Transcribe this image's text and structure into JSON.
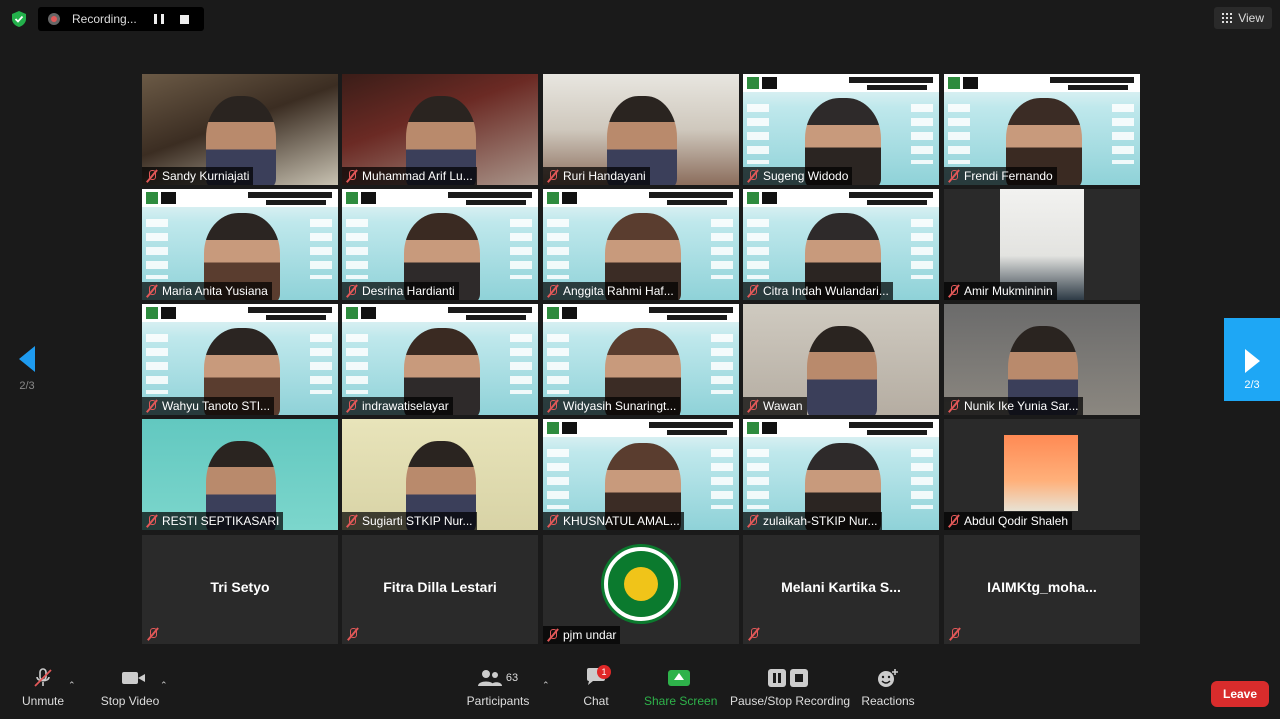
{
  "recording": {
    "label": "Recording..."
  },
  "view_button": {
    "label": "View"
  },
  "pagination": {
    "left_page": "2/3",
    "right_page": "2/3"
  },
  "tiles": [
    {
      "name": "Sandy Kurniajati",
      "cam": "room"
    },
    {
      "name": "Muhammad Arif Lu...",
      "cam": "red"
    },
    {
      "name": "Ruri Handayani",
      "cam": "bright"
    },
    {
      "name": "Sugeng Widodo",
      "cam": "slide"
    },
    {
      "name": "Frendi Fernando",
      "cam": "slide"
    },
    {
      "name": "Maria Anita Yusiana",
      "cam": "slide"
    },
    {
      "name": "Desrina Hardianti",
      "cam": "slide"
    },
    {
      "name": "Anggita Rahmi Haf...",
      "cam": "slide"
    },
    {
      "name": "Citra Indah Wulandari...",
      "cam": "slide",
      "active": true
    },
    {
      "name": "Amir Mukmininin",
      "cam": "amir"
    },
    {
      "name": "Wahyu Tanoto STI...",
      "cam": "slide"
    },
    {
      "name": "indrawatiselayar",
      "cam": "slide"
    },
    {
      "name": "Widyasih Sunaringt...",
      "cam": "slide"
    },
    {
      "name": "Wawan",
      "cam": "boy"
    },
    {
      "name": "Nunik Ike Yunia Sar...",
      "cam": "office"
    },
    {
      "name": "RESTI SEPTIKASARI",
      "cam": "green"
    },
    {
      "name": "Sugiarti STKIP Nur...",
      "cam": "yellow"
    },
    {
      "name": "KHUSNATUL AMAL...",
      "cam": "slide"
    },
    {
      "name": "zulaikah-STKIP Nur...",
      "cam": "slide"
    },
    {
      "name": "Abdul Qodir Shaleh",
      "cam": "portrait"
    }
  ],
  "video_off_tiles": [
    {
      "display_name": "Tri Setyo"
    },
    {
      "display_name": "Fitra Dilla Lestari"
    },
    {
      "name": "pjm undar",
      "logo": true
    },
    {
      "display_name": "Melani Kartika S..."
    },
    {
      "display_name": "IAIMKtg_moha..."
    }
  ],
  "toolbar": {
    "unmute": "Unmute",
    "stop_video": "Stop Video",
    "participants": "Participants",
    "participants_count": "63",
    "chat": "Chat",
    "chat_badge": "1",
    "share_screen": "Share Screen",
    "pause_stop_recording": "Pause/Stop Recording",
    "reactions": "Reactions",
    "leave": "Leave"
  },
  "colors": {
    "background": "#1a1a1a",
    "active_speaker": "#b8e833",
    "share_green": "#2eb24a",
    "leave_red": "#d92c2c",
    "nav_blue": "#1ea7f5",
    "muted_red": "#e25858"
  }
}
